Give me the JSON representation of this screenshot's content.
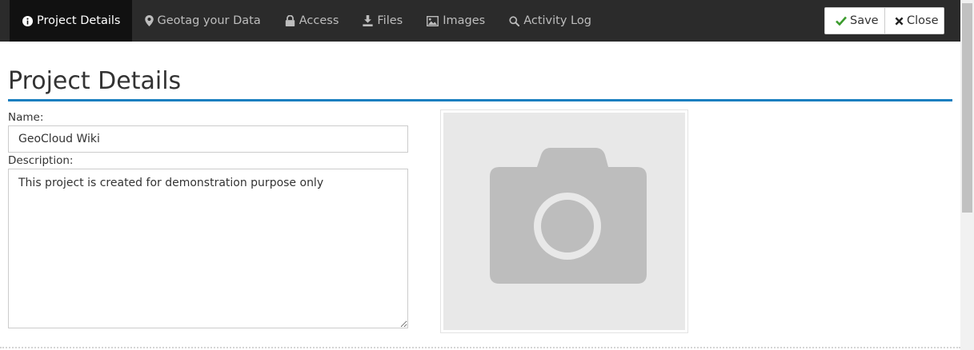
{
  "nav": {
    "tabs": [
      {
        "label": "Project Details",
        "icon": "info-circle-icon",
        "active": true
      },
      {
        "label": "Geotag your Data",
        "icon": "map-marker-icon",
        "active": false
      },
      {
        "label": "Access",
        "icon": "lock-icon",
        "active": false
      },
      {
        "label": "Files",
        "icon": "download-icon",
        "active": false
      },
      {
        "label": "Images",
        "icon": "image-icon",
        "active": false
      },
      {
        "label": "Activity Log",
        "icon": "search-icon",
        "active": false
      }
    ],
    "save_label": "Save",
    "close_label": "Close"
  },
  "page": {
    "title": "Project Details",
    "accent_color": "#1a7fc0"
  },
  "form": {
    "name_label": "Name:",
    "name_value": "GeoCloud Wiki",
    "description_label": "Description:",
    "description_value": "This project is created for demonstration purpose only"
  },
  "image": {
    "icon": "camera-icon"
  }
}
